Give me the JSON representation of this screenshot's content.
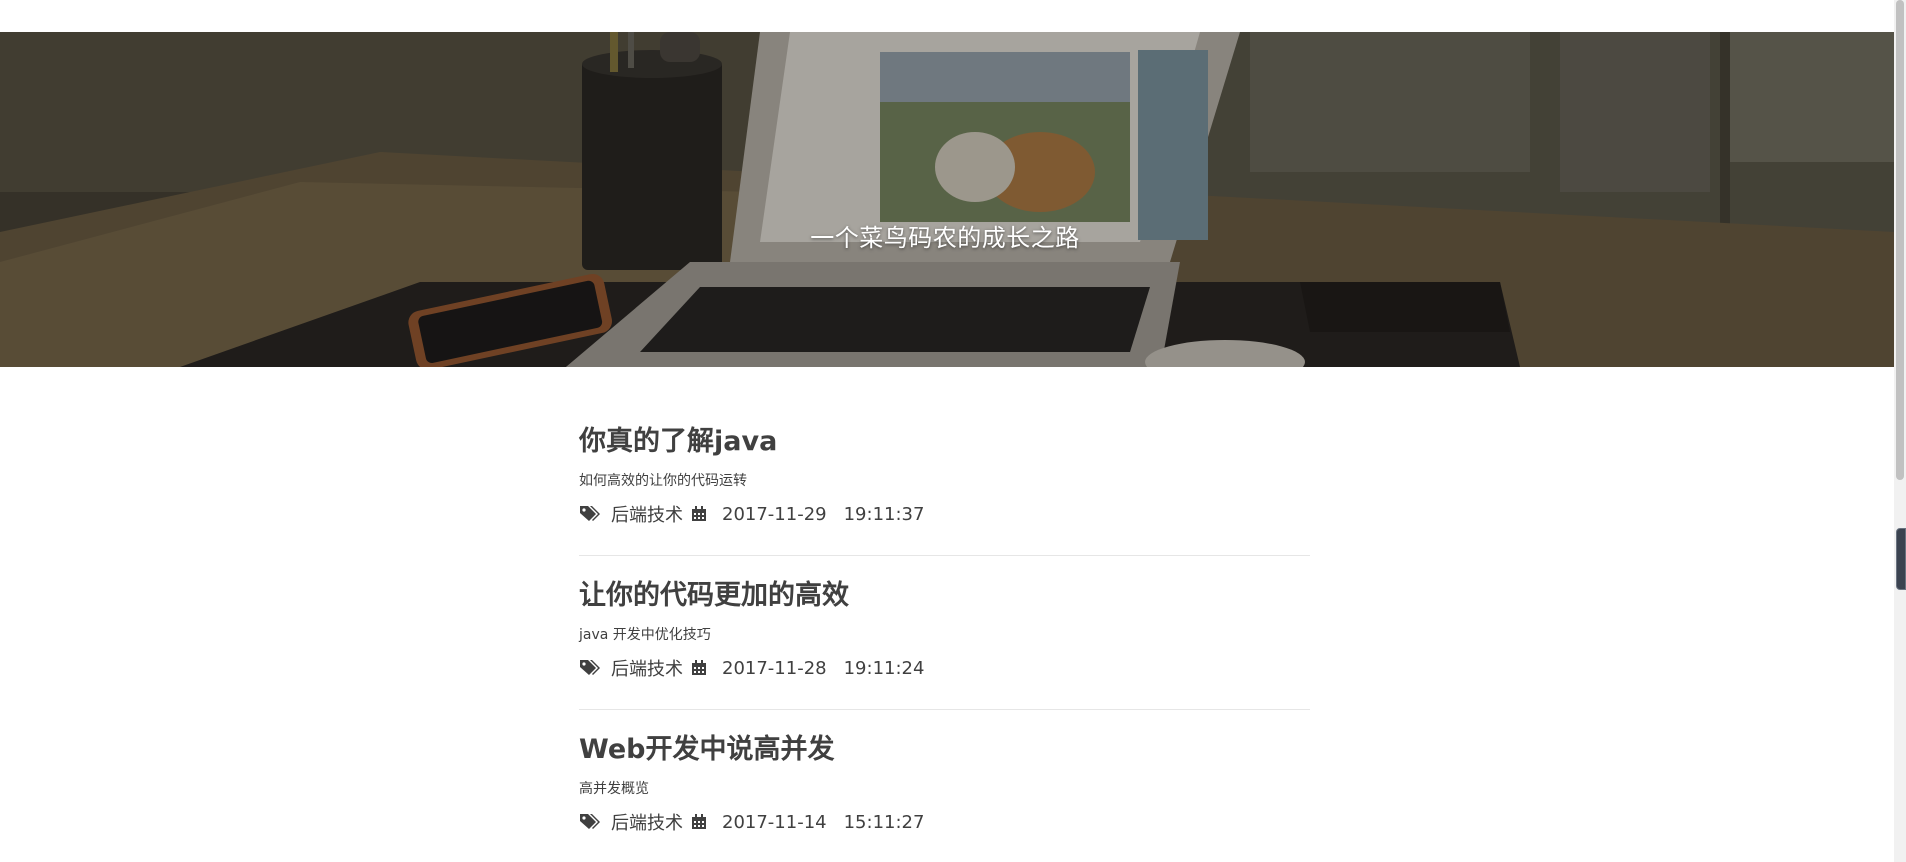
{
  "hero": {
    "title": "一个菜鸟码农的成长之路"
  },
  "posts": [
    {
      "title": "你真的了解java",
      "subtitle": "如何高效的让你的代码运转",
      "category": "后端技术",
      "date": "2017-11-29",
      "time": "19:11:37"
    },
    {
      "title": "让你的代码更加的高效",
      "subtitle": "java 开发中优化技巧",
      "category": "后端技术",
      "date": "2017-11-28",
      "time": "19:11:24"
    },
    {
      "title": "Web开发中说高并发",
      "subtitle": "高并发概览",
      "category": "后端技术",
      "date": "2017-11-14",
      "time": "15:11:27"
    }
  ],
  "icons": {
    "tag": "tags-icon",
    "calendar": "calendar-icon"
  },
  "colors": {
    "text": "#404040",
    "divider": "#e6e6e6",
    "hero_overlay": "#3a352c"
  }
}
